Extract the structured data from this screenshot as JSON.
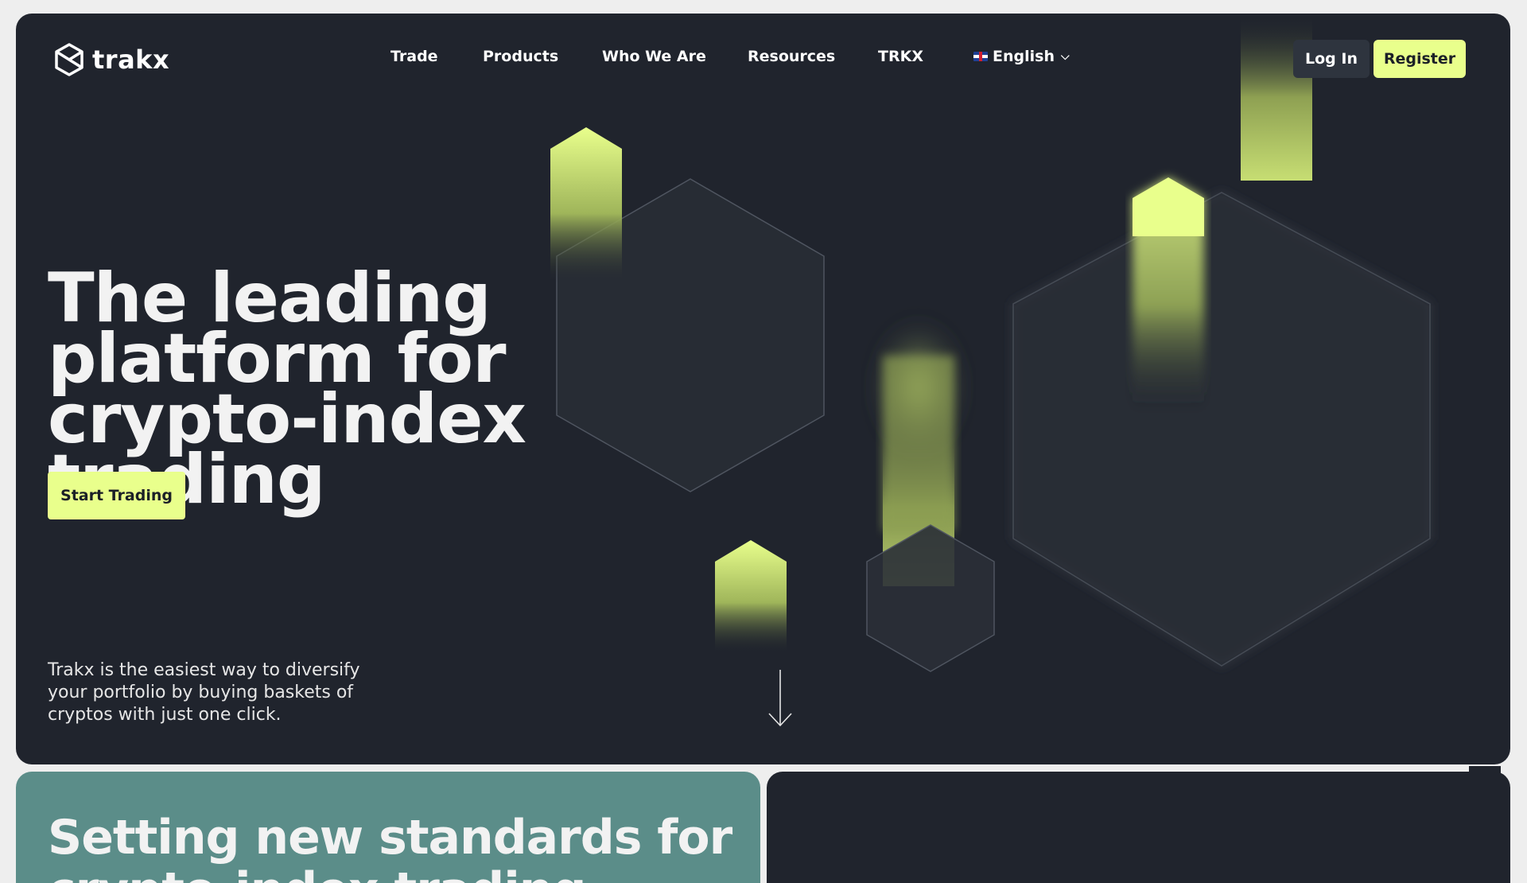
{
  "brand": {
    "name": "trakx"
  },
  "nav": {
    "items": [
      "Trade",
      "Products",
      "Who We Are",
      "Resources",
      "TRKX"
    ],
    "language": "English"
  },
  "auth": {
    "login_label": "Log In",
    "register_label": "Register"
  },
  "hero": {
    "headline": "The leading platform for crypto-index trading",
    "cta_label": "Start Trading",
    "description": "Trakx is the easiest way to diversify your portfolio by buying baskets of cryptos with just one click."
  },
  "section": {
    "heading": "Setting new standards for crypto-index trading"
  },
  "colors": {
    "background": "#20242d",
    "accent": "#e9ff8c",
    "teal_panel": "#5b8d89"
  }
}
